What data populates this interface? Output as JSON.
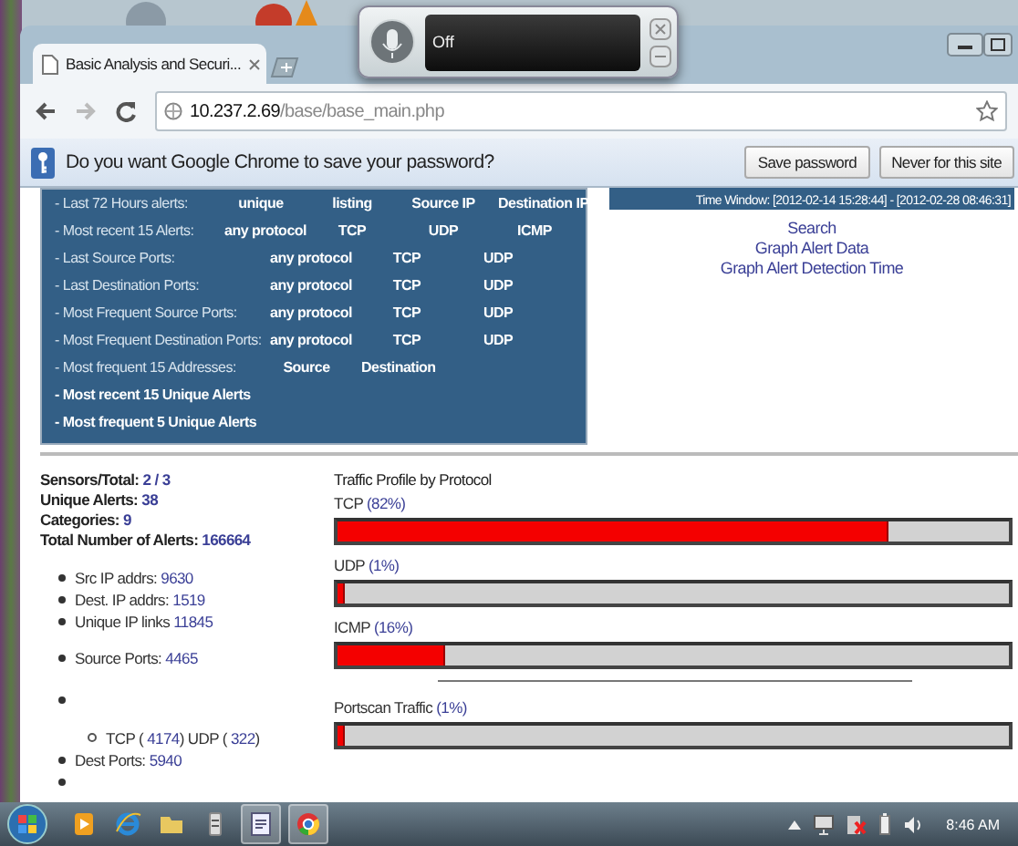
{
  "speech_widget": {
    "status": "Off"
  },
  "browser": {
    "tab_title": "Basic Analysis and Securi...",
    "url_host": "10.237.2.69",
    "url_path": "/base/base_main.php"
  },
  "password_bar": {
    "message": "Do you want Google Chrome to save your password?",
    "buttons": [
      "Save password",
      "Never for this site"
    ]
  },
  "alert_menu": [
    {
      "kind": "row",
      "label": "- Last 72 Hours alerts:",
      "links": [
        "unique",
        "listing",
        "Source IP",
        "Destination IP"
      ]
    },
    {
      "kind": "row",
      "label": "- Most recent 15 Alerts:",
      "links": [
        "any protocol",
        "TCP",
        "UDP",
        "ICMP"
      ]
    },
    {
      "kind": "row",
      "label": "- Last Source Ports:",
      "links": [
        "any protocol",
        "TCP",
        "UDP"
      ]
    },
    {
      "kind": "row",
      "label": "- Last Destination Ports:",
      "links": [
        "any protocol",
        "TCP",
        "UDP"
      ]
    },
    {
      "kind": "row",
      "label": "- Most Frequent Source Ports:",
      "links": [
        "any protocol",
        "TCP",
        "UDP"
      ]
    },
    {
      "kind": "row",
      "label": "- Most Frequent Destination Ports:",
      "links": [
        "any protocol",
        "TCP",
        "UDP"
      ]
    },
    {
      "kind": "row",
      "label": "- Most frequent 15 Addresses:",
      "links": [
        "Source",
        "Destination"
      ]
    },
    {
      "kind": "link",
      "label": "- Most recent 15 Unique Alerts"
    },
    {
      "kind": "link",
      "label": "- Most frequent 5 Unique Alerts"
    }
  ],
  "time_window": "Time Window: [2012-02-14 15:28:44] - [2012-02-28 08:46:31]",
  "side_links": [
    "Search",
    "Graph Alert Data",
    "Graph Alert Detection Time"
  ],
  "stats": [
    {
      "label": "Sensors/Total:",
      "value": "2 / 3"
    },
    {
      "label": "Unique Alerts:",
      "value": "38"
    },
    {
      "label": "Categories:",
      "value": "9"
    },
    {
      "label": "Total Number of Alerts:",
      "value": "166664"
    }
  ],
  "address_list": [
    {
      "label": "Src IP addrs:",
      "value": "9630"
    },
    {
      "label": "Dest. IP addrs:",
      "value": "1519"
    },
    {
      "label": "Unique IP links",
      "value": "11845"
    }
  ],
  "port_list": [
    {
      "kind": "item",
      "label": "Source Ports:",
      "value": "4465"
    },
    {
      "kind": "empty"
    },
    {
      "kind": "sub",
      "parts": [
        {
          "label": "TCP (",
          "value": "4174"
        },
        {
          "label": ") UDP (",
          "value": "322"
        },
        {
          "label": ")"
        }
      ]
    },
    {
      "kind": "item",
      "label": "Dest Ports:",
      "value": "5940"
    },
    {
      "kind": "empty"
    }
  ],
  "traffic_profile": {
    "title": "Traffic Profile by Protocol",
    "bars": [
      {
        "label": "TCP",
        "value": "(82%)",
        "level": 0.82
      },
      {
        "label": "UDP",
        "value": "(1%)",
        "level": 0.01
      },
      {
        "label": "ICMP",
        "value": "(16%)",
        "level": 0.16
      }
    ],
    "portscan": {
      "label": "Portscan Traffic",
      "value": "(1%)",
      "level": 0.01
    }
  },
  "taskbar": {
    "time": "8:46 AM"
  }
}
